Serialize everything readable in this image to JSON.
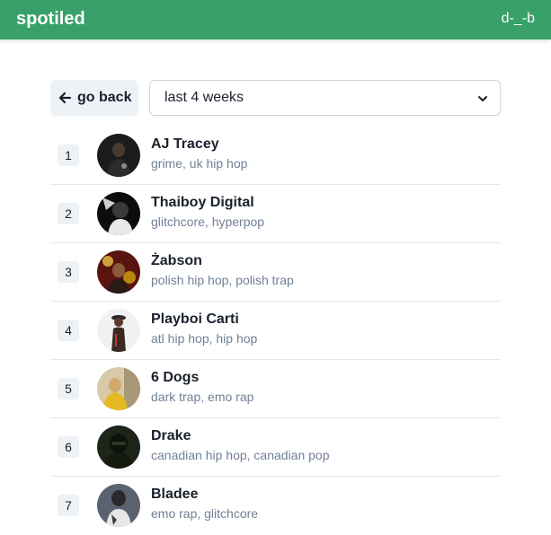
{
  "header": {
    "brand": "spotiled",
    "user": "d-_-b"
  },
  "controls": {
    "back_label": "go back",
    "range_selected": "last 4 weeks"
  },
  "artists": [
    {
      "rank": "1",
      "name": "AJ Tracey",
      "genres": "grime, uk hip hop"
    },
    {
      "rank": "2",
      "name": "Thaiboy Digital",
      "genres": "glitchcore, hyperpop"
    },
    {
      "rank": "3",
      "name": "Żabson",
      "genres": "polish hip hop, polish trap"
    },
    {
      "rank": "4",
      "name": "Playboi Carti",
      "genres": "atl hip hop, hip hop"
    },
    {
      "rank": "5",
      "name": "6 Dogs",
      "genres": "dark trap, emo rap"
    },
    {
      "rank": "6",
      "name": "Drake",
      "genres": "canadian hip hop, canadian pop"
    },
    {
      "rank": "7",
      "name": "Bladee",
      "genres": "emo rap, glitchcore"
    }
  ]
}
